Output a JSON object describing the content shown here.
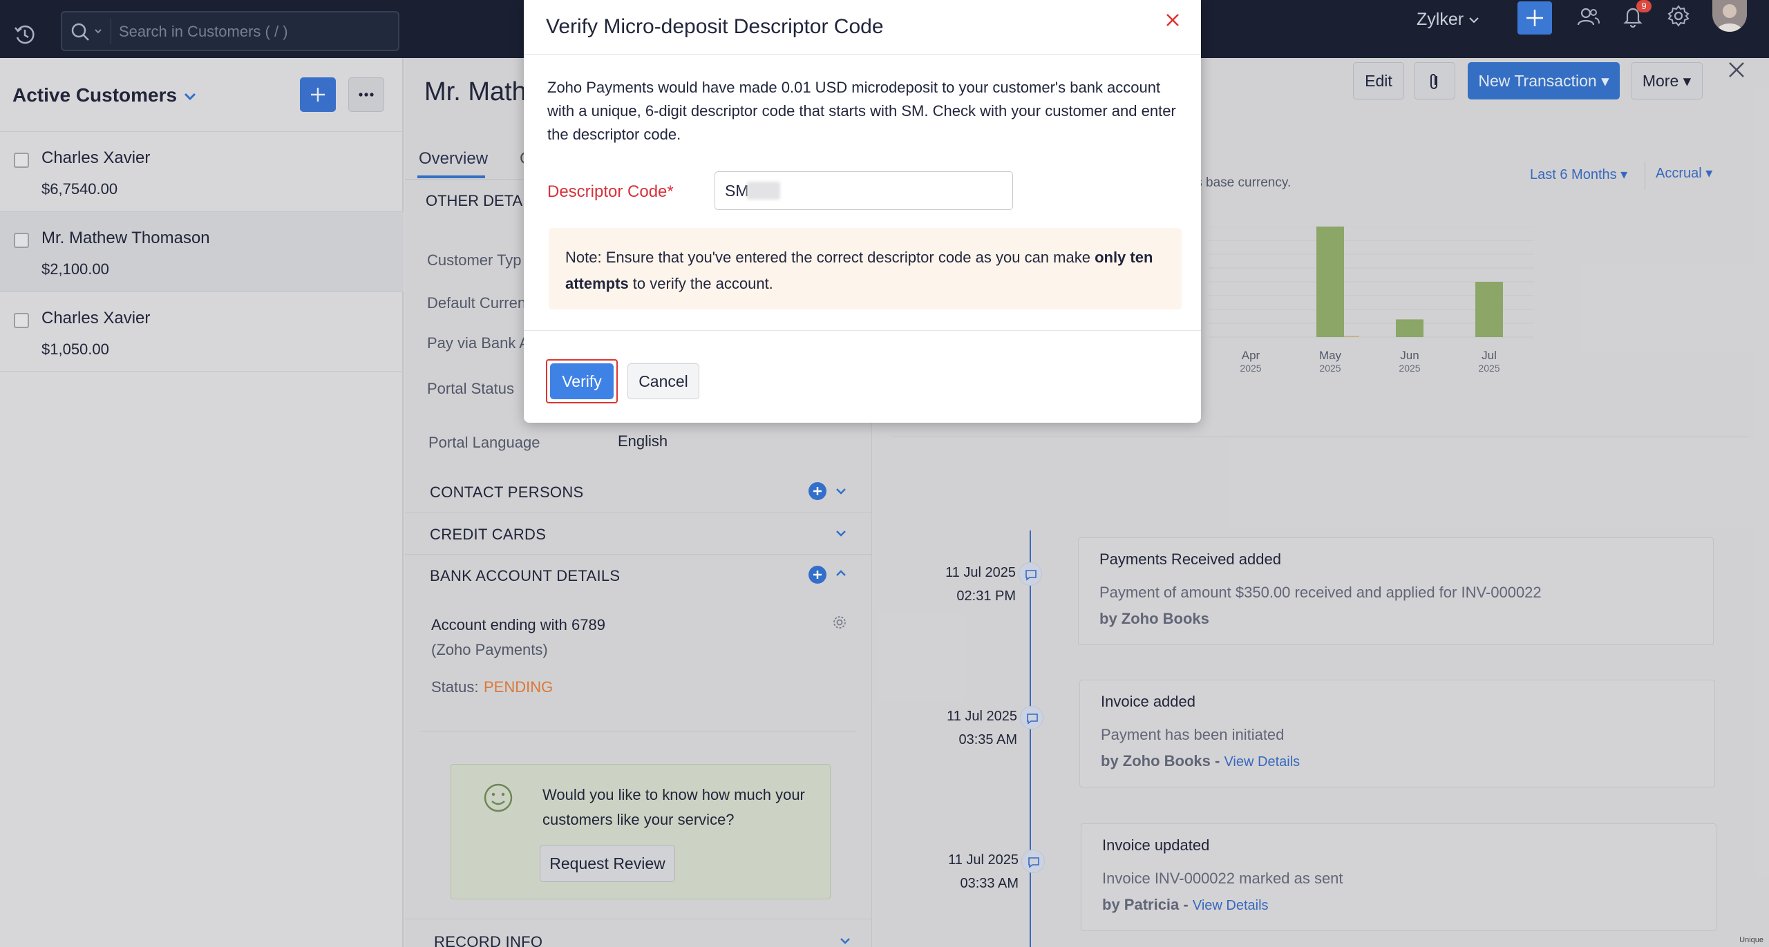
{
  "topbar": {
    "search_placeholder": "Search in Customers ( / )",
    "org_name": "Zylker",
    "notification_count": "9",
    "icons": [
      "recent-activity-icon",
      "search-icon",
      "plus-icon",
      "users-icon",
      "bell-icon",
      "gear-icon",
      "avatar"
    ]
  },
  "sidebar": {
    "title": "Active Customers",
    "customers": [
      {
        "name": "Charles Xavier",
        "amount": "$6,7540.00"
      },
      {
        "name": "Mr. Mathew Thomason",
        "amount": "$2,100.00"
      },
      {
        "name": "Charles Xavier",
        "amount": "$1,050.00"
      }
    ]
  },
  "header": {
    "customer_name": "Mr. Math",
    "edit_label": "Edit",
    "new_transaction_label": "New Transaction",
    "more_label": "More"
  },
  "tabs": {
    "overview": "Overview",
    "other": "C"
  },
  "details": {
    "other_details_heading": "OTHER DETAIL",
    "customer_type_label": "Customer Typ",
    "default_currency_label": "Default Curren",
    "pay_via_bank_label": "Pay via Bank A",
    "portal_status_label": "Portal Status",
    "portal_language_label": "Portal Language",
    "portal_language_value": "English",
    "contact_persons": "CONTACT PERSONS",
    "credit_cards": "CREDIT CARDS",
    "bank_account_details": "BANK ACCOUNT DETAILS",
    "account_ending": "Account ending with 6789",
    "account_provider": "(Zoho Payments)",
    "status_label": "Status:",
    "status_value": "PENDING",
    "review_prompt": "Would you like to know how much your customers like your service?",
    "request_review_label": "Request Review",
    "record_info": "RECORD INFO"
  },
  "chart": {
    "note": "tion's base currency.",
    "period_label": "Last 6 Months",
    "basis_label": "Accrual"
  },
  "chart_data": {
    "type": "bar",
    "categories": [
      "Apr 2025",
      "May 2025",
      "Jun 2025",
      "Jul 2025"
    ],
    "series": [
      {
        "values": [
          0,
          100,
          16,
          50
        ]
      },
      {
        "values": [
          0,
          1,
          0,
          0
        ]
      }
    ],
    "colors": [
      "#8eaa6a",
      "#c9b37a"
    ]
  },
  "timeline": [
    {
      "date": "11 Jul 2025",
      "time": "02:31 PM",
      "title": "Payments Received added",
      "desc": "Payment of amount $350.00 received and applied for INV-000022",
      "by": "by Zoho Books",
      "link": ""
    },
    {
      "date": "11 Jul 2025",
      "time": "03:35 AM",
      "title": "Invoice added",
      "desc": "Payment has been initiated",
      "by": "by Zoho Books",
      "link": "View Details"
    },
    {
      "date": "11 Jul 2025",
      "time": "03:33 AM",
      "title": "Invoice updated",
      "desc": "Invoice INV-000022 marked as sent",
      "by": "by Patricia",
      "link": "View Details"
    }
  ],
  "modal": {
    "title": "Verify Micro-deposit Descriptor Code",
    "description": "Zoho Payments would have made 0.01 USD microdeposit to your customer's bank account with a unique, 6-digit descriptor code that starts with SM. Check with your customer and enter the descriptor code.",
    "code_label": "Descriptor Code*",
    "code_value": "SM",
    "note_prefix": "Note: Ensure that you've entered the correct descriptor code as you can make ",
    "note_bold": "only ten attempts",
    "note_suffix": " to verify the account.",
    "verify_label": "Verify",
    "cancel_label": "Cancel"
  },
  "watermark": "Unique",
  "colors": {
    "accent": "#3f82e6",
    "danger": "#e0342f",
    "pending": "#e07b39",
    "topbar": "#1b2134"
  }
}
